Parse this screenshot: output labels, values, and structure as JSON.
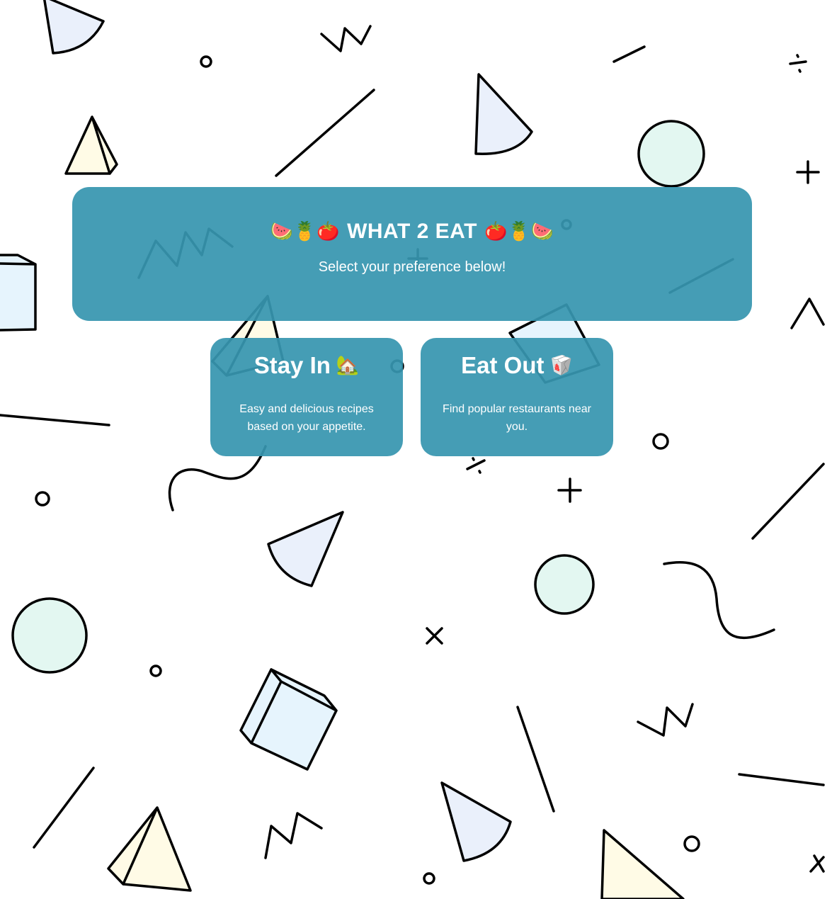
{
  "header": {
    "emoji_left": "🍉🍍🍅",
    "title": "WHAT 2 EAT",
    "emoji_right": "🍅🍍🍉",
    "subtitle": "Select your preference below!"
  },
  "cards": [
    {
      "title": "Stay In",
      "emoji": "🏡",
      "description": "Easy and delicious recipes based on your appetite."
    },
    {
      "title": "Eat Out",
      "emoji": "🥡",
      "description": "Find popular restaurants near you."
    }
  ],
  "colors": {
    "panel": "#3796af",
    "text": "#ffffff",
    "cone_fill": "#eaf0fb",
    "pyramid_fill": "#fffbe6",
    "circle_fill": "#e3f7f1",
    "cube_fill": "#e6f4fd"
  }
}
